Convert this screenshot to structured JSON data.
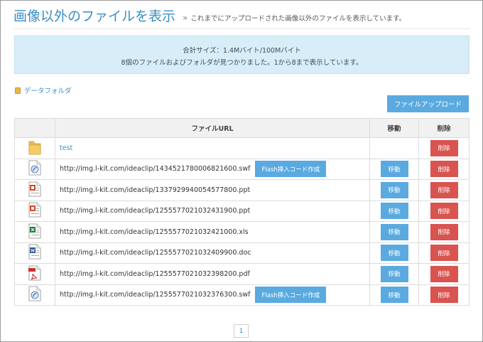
{
  "header": {
    "title": "画像以外のファイルを表示",
    "separator": "»",
    "subtitle": "これまでにアップロードされた画像以外のファイルを表示しています。"
  },
  "info": {
    "line1": "合計サイズ：1.4Mバイト/100Mバイト",
    "line2": "8個のファイルおよびフォルダが見つかりました。1から8まで表示しています。"
  },
  "data_folder_label": "データフォルダ",
  "upload_button_label": "ファイルアップロード",
  "table": {
    "headers": {
      "icon": "",
      "url": "ファイルURL",
      "move": "移動",
      "delete": "削除"
    },
    "rows": [
      {
        "type": "folder",
        "icon": "folder-icon",
        "text": "test",
        "flash": false,
        "move": false,
        "delete": "削除"
      },
      {
        "type": "swf",
        "icon": "swf-file-icon",
        "text": "http://img.l-kit.com/ideaclip/1434521780006821600.swf",
        "flash": true,
        "move": true,
        "delete": "削除"
      },
      {
        "type": "ppt",
        "icon": "ppt-file-icon",
        "text": "http://img.l-kit.com/ideaclip/1337929940054577800.ppt",
        "flash": false,
        "move": true,
        "delete": "削除"
      },
      {
        "type": "ppt",
        "icon": "ppt-file-icon",
        "text": "http://img.l-kit.com/ideaclip/1255577021032431900.ppt",
        "flash": false,
        "move": true,
        "delete": "削除"
      },
      {
        "type": "xls",
        "icon": "xls-file-icon",
        "text": "http://img.l-kit.com/ideaclip/1255577021032421000.xls",
        "flash": false,
        "move": true,
        "delete": "削除"
      },
      {
        "type": "doc",
        "icon": "doc-file-icon",
        "text": "http://img.l-kit.com/ideaclip/1255577021032409900.doc",
        "flash": false,
        "move": true,
        "delete": "削除"
      },
      {
        "type": "pdf",
        "icon": "pdf-file-icon",
        "text": "http://img.l-kit.com/ideaclip/1255577021032398200.pdf",
        "flash": false,
        "move": true,
        "delete": "削除"
      },
      {
        "type": "swf",
        "icon": "swf-file-icon",
        "text": "http://img.l-kit.com/ideaclip/1255577021032376300.swf",
        "flash": true,
        "move": true,
        "delete": "削除"
      }
    ],
    "flash_label": "Flash挿入コード作成",
    "move_label": "移動"
  },
  "pagination": {
    "current": "1"
  },
  "colors": {
    "accent": "#5aaae0",
    "title": "#3b8fc4",
    "danger": "#d9534f",
    "info_bg": "#d8edf7"
  }
}
